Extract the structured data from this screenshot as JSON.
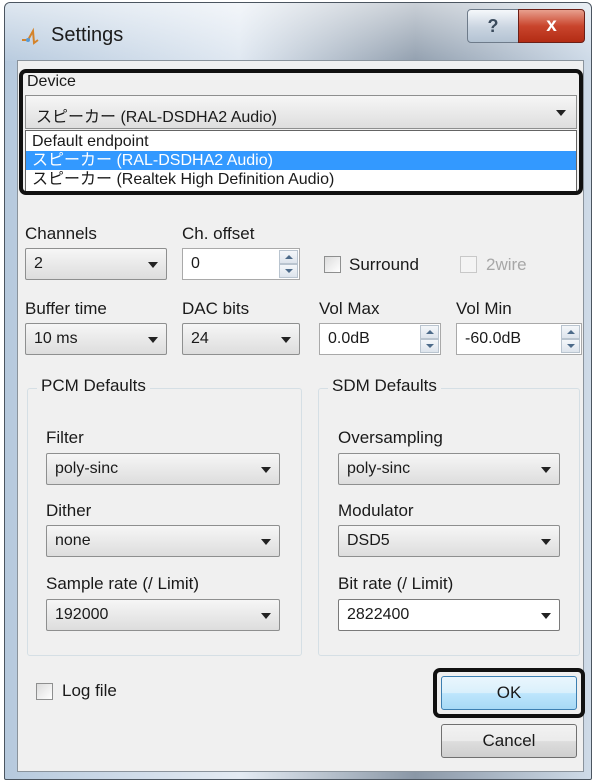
{
  "window": {
    "title": "Settings",
    "help_label": "?",
    "close_label": "x"
  },
  "device": {
    "label": "Device",
    "selected": "スピーカー (RAL-DSDHA2 Audio)",
    "options": [
      "Default endpoint",
      "スピーカー (RAL-DSDHA2 Audio)",
      "スピーカー (Realtek High Definition Audio)"
    ],
    "highlighted_index": 1
  },
  "channels": {
    "label": "Channels",
    "value": "2"
  },
  "ch_offset": {
    "label": "Ch. offset",
    "value": "0"
  },
  "surround": {
    "label": "Surround",
    "checked": false
  },
  "two_wire": {
    "label": "2wire",
    "checked": false,
    "enabled": false
  },
  "buffer_time": {
    "label": "Buffer time",
    "value": "10 ms"
  },
  "dac_bits": {
    "label": "DAC bits",
    "value": "24"
  },
  "vol_max": {
    "label": "Vol Max",
    "value": "0.0dB"
  },
  "vol_min": {
    "label": "Vol Min",
    "value": "-60.0dB"
  },
  "pcm": {
    "title": "PCM Defaults",
    "filter_label": "Filter",
    "filter_value": "poly-sinc",
    "dither_label": "Dither",
    "dither_value": "none",
    "rate_label": "Sample rate (/ Limit)",
    "rate_value": "192000"
  },
  "sdm": {
    "title": "SDM Defaults",
    "oversampling_label": "Oversampling",
    "oversampling_value": "poly-sinc",
    "modulator_label": "Modulator",
    "modulator_value": "DSD5",
    "rate_label": "Bit rate (/ Limit)",
    "rate_value": "2822400"
  },
  "log_file": {
    "label": "Log file",
    "checked": false
  },
  "buttons": {
    "ok": "OK",
    "cancel": "Cancel"
  },
  "colors": {
    "selection": "#3399ff",
    "default_button": "#bee6fd",
    "highlight_frame": "#111111",
    "close_button": "#c9452d"
  }
}
